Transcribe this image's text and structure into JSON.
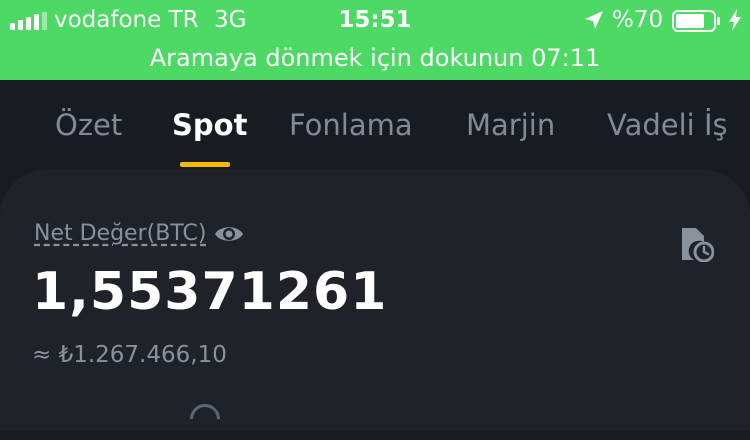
{
  "status_bar": {
    "carrier": "vodafone TR",
    "network": "3G",
    "time": "15:51",
    "battery": "%70",
    "icons": [
      "signal-icon",
      "location-arrow-icon",
      "battery-icon",
      "charging-bolt-icon"
    ],
    "background_color": "#4cd964"
  },
  "call_banner": {
    "text": "Aramaya dönmek için dokunun 07:11"
  },
  "tabs": {
    "items": [
      {
        "label": "Özet"
      },
      {
        "label": "Spot"
      },
      {
        "label": "Fonlama"
      },
      {
        "label": "Marjin"
      },
      {
        "label": "Vadeli İş"
      }
    ],
    "active": "Spot",
    "accent_color": "#f0b90b"
  },
  "balance": {
    "label": "Net Değer(BTC)",
    "value": "1,55371261",
    "fiat": "≈ ₺1.267.466,10",
    "icons": [
      "eye-icon",
      "history-icon"
    ]
  }
}
